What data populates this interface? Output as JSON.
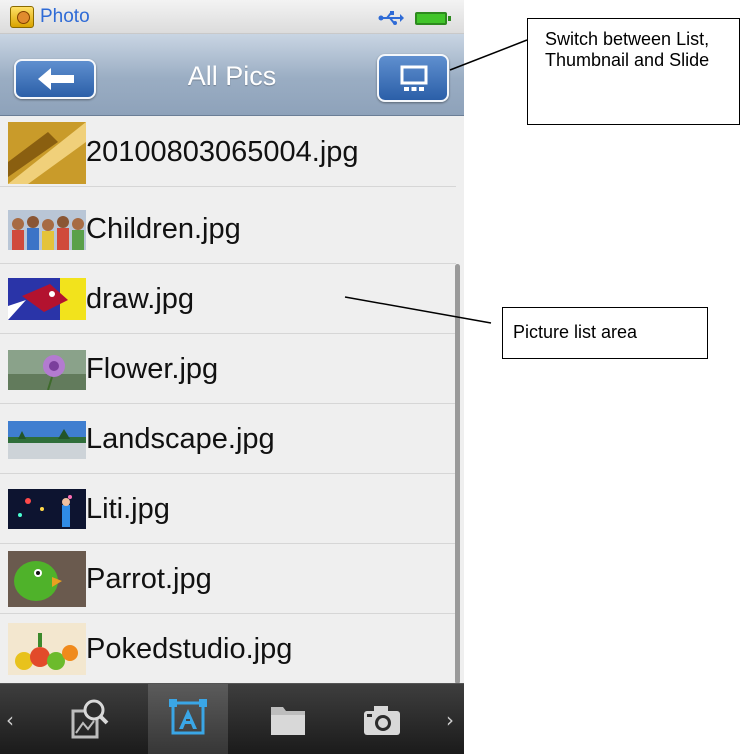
{
  "status_bar": {
    "app_title": "Photo",
    "app_icon": "photo-app-icon",
    "icons": [
      "usb-icon",
      "battery-icon"
    ]
  },
  "nav_bar": {
    "title": "All Pics",
    "back_icon": "back-arrow-icon",
    "view_icon": "view-mode-icon"
  },
  "picture_list": {
    "items": [
      {
        "name": "20100803065004.jpg",
        "thumb": "golden-abstract"
      },
      {
        "name": "Children.jpg",
        "thumb": "children-group"
      },
      {
        "name": "draw.jpg",
        "thumb": "bird-drawing"
      },
      {
        "name": "Flower.jpg",
        "thumb": "purple-flower"
      },
      {
        "name": "Landscape.jpg",
        "thumb": "landscape"
      },
      {
        "name": "Liti.jpg",
        "thumb": "night-scene"
      },
      {
        "name": "Parrot.jpg",
        "thumb": "green-parrot"
      },
      {
        "name": "Pokedstudio.jpg",
        "thumb": "fruit-illustration"
      }
    ]
  },
  "toolbar": {
    "buttons": [
      "search-icon",
      "all-pics-icon",
      "folder-icon",
      "camera-icon"
    ],
    "active": "all-pics-icon",
    "left_arrow": "‹",
    "right_arrow": "›"
  },
  "annotations": {
    "switch_view": "Switch between List, Thumbnail and Slide",
    "picture_list_area": "Picture list area"
  },
  "colors": {
    "app_title": "#2f6bd6",
    "nav_bar": "#9aadc3",
    "nav_button": "#2b5fa8",
    "list_background": "#efefef",
    "toolbar": "#1b1b1b"
  }
}
